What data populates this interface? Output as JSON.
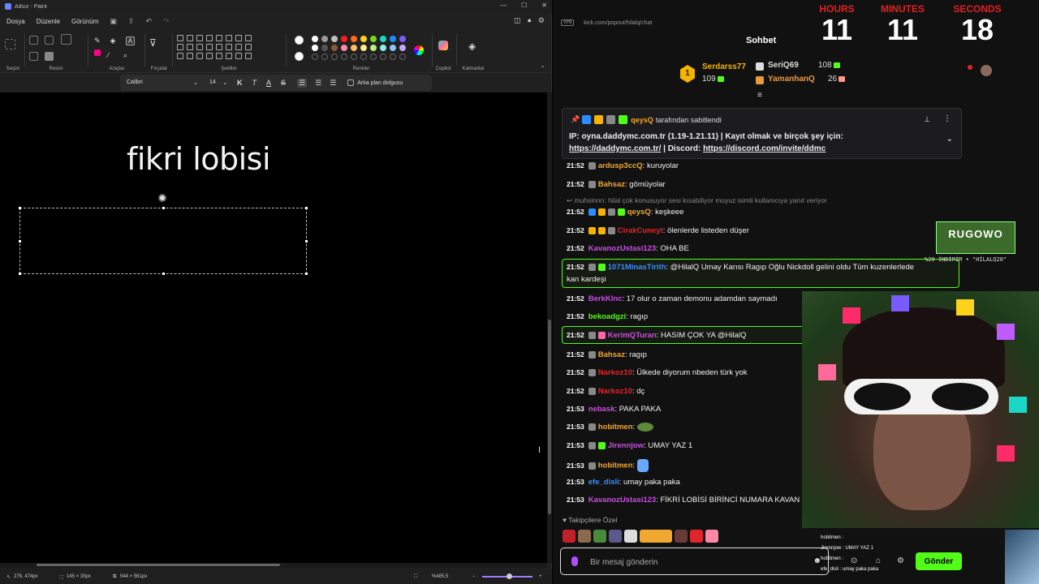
{
  "paint": {
    "title": "Adsız - Paint",
    "window_controls": [
      "—",
      "☐",
      "✕"
    ],
    "menu": [
      "Dosya",
      "Düzenle",
      "Görünüm"
    ],
    "ribbon_labels": {
      "selection": "Seçim",
      "image": "Resim",
      "tools": "Araçlar",
      "brushes": "Fırçalar",
      "shapes": "Şekiller",
      "colors": "Renkler",
      "copilot": "Copilot",
      "layers": "Katmanlar"
    },
    "palette": [
      "#ffffff",
      "#9a9a9a",
      "#c0c0c0",
      "#ff1b1b",
      "#ff6a1b",
      "#ffd21b",
      "#7ad81b",
      "#1bd7c6",
      "#1b8cff",
      "#7a5bff",
      "#c05bff"
    ],
    "text_toolbar": {
      "font": "Calibri",
      "size": "14",
      "bold": "K",
      "italic": "T",
      "underline": "A",
      "strike": "S",
      "background_fill_label": "Arka plan dolgusu"
    },
    "canvas_text": "fikri lobisi",
    "status": {
      "cursor_pos": "278, 474px",
      "selection_size": "145 × 33px",
      "canvas_size": "544 × 561px",
      "zoom": "%485,5"
    }
  },
  "browser": {
    "url": "kick.com/popout/hilalq/chat",
    "vpn_label": "VPN"
  },
  "timer": {
    "hours_label": "HOURS",
    "minutes_label": "MINUTES",
    "seconds_label": "SECONDS",
    "hours": "11",
    "minutes": "11",
    "seconds": "18"
  },
  "chat": {
    "title": "Sohbet",
    "leaderboard": [
      {
        "rank": "1",
        "name": "Serdarss77",
        "count": "109",
        "color": "#f5b400"
      },
      {
        "rank": "2",
        "name": "SeriQ69",
        "count": "108",
        "color": "#dddddd"
      },
      {
        "rank": "3",
        "name": "YamanhanQ",
        "count": "26",
        "color": "#e89a3c"
      }
    ],
    "pinned": {
      "pinned_by_user": "qeysQ",
      "pinned_by_text": "tarafından sabitlendi",
      "line1": "IP: oyna.daddymc.com.tr (1.19-1.21.11) | Kayıt olmak ve birçok şey için:",
      "link1": "https://daddymc.com.tr/",
      "separator": " | Discord: ",
      "link2": "https://discord.com/invite/ddmc"
    },
    "reply_line": "muhsinnn: hilal çok konusuyor sesi kısabiliyor muyuz isimli kullanıcıya yanıt veriyor",
    "messages": [
      {
        "time": "21:52",
        "user": "ardusp3ccQ",
        "color": "#f0a830",
        "text": ": kuruyolar"
      },
      {
        "time": "21:52",
        "user": "Bahsaz",
        "color": "#f0a830",
        "text": ": gömüyolar"
      },
      {
        "time": "21:52",
        "user": "qeysQ",
        "color": "#f0a830",
        "text": ": keşkeee"
      },
      {
        "time": "21:52",
        "user": "CirakCuneyt",
        "color": "#e0262b",
        "text": ": ölenlerde listeden düşer"
      },
      {
        "time": "21:52",
        "user": "KavanozUstasi123",
        "color": "#c84fe0",
        "text": ": OHA BE"
      },
      {
        "time": "21:52",
        "user": "1071MinasTirith",
        "color": "#3b8cff",
        "text": ": @HilalQ Umay Karısı Ragıp Oğlu Nickdoll gelini oldu Tüm kuzenlerlede",
        "text2": "kan kardeşi"
      },
      {
        "time": "21:52",
        "user": "BerkKlnc",
        "color": "#c84fe0",
        "text": ": 17 olur o zaman demonu adamdan saymadı"
      },
      {
        "time": "21:52",
        "user": "bekoadgzi",
        "color": "#53fc18",
        "text": ": ragıp"
      },
      {
        "time": "21:52",
        "user": "KerimQTuran",
        "color": "#c84fe0",
        "text": ": HASIM ÇOK YA @HilalQ"
      },
      {
        "time": "21:52",
        "user": "Bahsaz",
        "color": "#f0a830",
        "text": ": ragıp"
      },
      {
        "time": "21:52",
        "user": "Narkoz10",
        "color": "#e0262b",
        "text": ": Ülkede diyorum nbeden türk yok"
      },
      {
        "time": "21:52",
        "user": "Narkoz10",
        "color": "#e0262b",
        "text": ": dç"
      },
      {
        "time": "21:53",
        "user": "nebask",
        "color": "#c84fe0",
        "text": ": PAKA PAKA"
      },
      {
        "time": "21:53",
        "user": "hobitmen",
        "color": "#f0a830",
        "text": ":"
      },
      {
        "time": "21:53",
        "user": "Jirennjow",
        "color": "#c84fe0",
        "text": ": UMAY YAZ 1"
      },
      {
        "time": "21:53",
        "user": "hobitmen",
        "color": "#f0a830",
        "text": ":"
      },
      {
        "time": "21:53",
        "user": "efe_disli",
        "color": "#3b8cff",
        "text": ": umay paka paka"
      },
      {
        "time": "21:53",
        "user": "KavanozUstasi123",
        "color": "#c84fe0",
        "text": ": FİKRİ LOBİSİ BİRİNCİ NUMARA KAVAN"
      }
    ],
    "followers_only": "Takipçilere Özel",
    "input_placeholder": "Bir mesaj gönderin",
    "send_label": "Gönder"
  },
  "overlay": {
    "logo_text": "RUGOWO",
    "logo_caption": "%20 İNDİRİM • \"HİLALQ20\"",
    "mini_chat": [
      "hobitmen :",
      "Jirennjow : UMAY YAZ 1",
      "hobitmen :",
      "efe_disli : umay paka paka"
    ]
  }
}
